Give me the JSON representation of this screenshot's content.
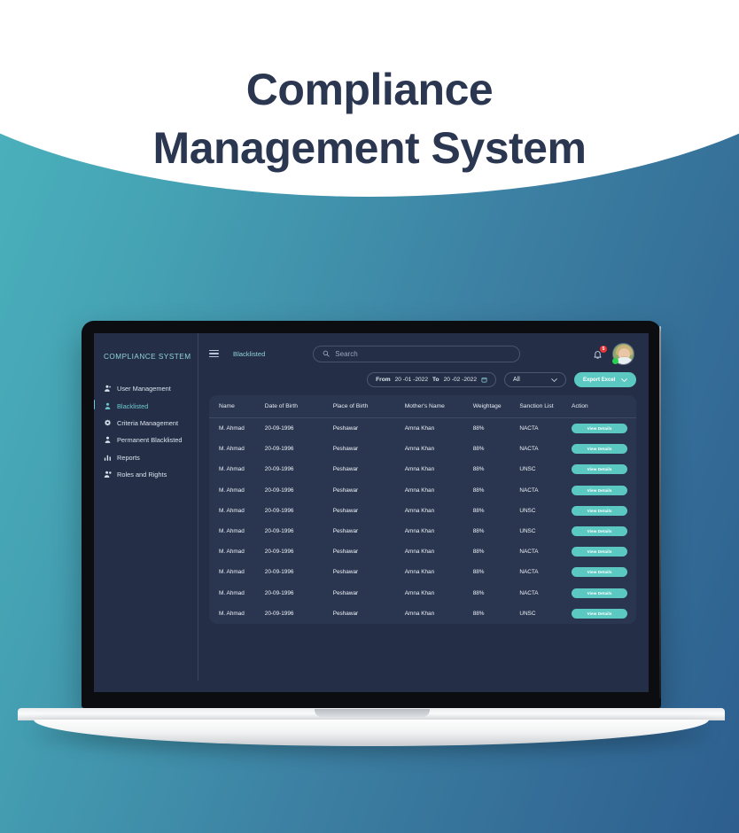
{
  "hero": {
    "title_line1": "Compliance",
    "title_line2": "Management System",
    "title_color": "#2b3750"
  },
  "theme": {
    "background_left": "#4cb3bd",
    "background_right": "#2d5e8e",
    "app_background": "#242f47",
    "card_background": "#2a3650",
    "accent": "#5cc8c2",
    "active_nav": "#6fc9cf",
    "badge_red": "#e8363b",
    "online_green": "#2ad04f"
  },
  "sidebar": {
    "brand": "COMPLIANCE SYSTEM",
    "items": [
      {
        "label": "User Management",
        "icon": "users-icon",
        "active": false
      },
      {
        "label": "Blacklisted",
        "icon": "user-block-icon",
        "active": true
      },
      {
        "label": "Criteria Management",
        "icon": "gear-icon",
        "active": false
      },
      {
        "label": "Permanent Blacklisted",
        "icon": "user-icon",
        "active": false
      },
      {
        "label": "Reports",
        "icon": "bar-chart-icon",
        "active": false
      },
      {
        "label": "Roles and Rights",
        "icon": "user-settings-icon",
        "active": false
      }
    ]
  },
  "topbar": {
    "menu_icon": "hamburger-icon",
    "breadcrumb": "Blacklisted",
    "search": {
      "icon": "search-icon",
      "placeholder": "Search",
      "value": ""
    },
    "notifications": {
      "icon": "bell-icon",
      "count": "5"
    },
    "avatar": {
      "icon": "avatar",
      "status": "online"
    }
  },
  "filters": {
    "date_range": {
      "from_label": "From",
      "from_value": "20 -01 -2022",
      "to_label": "To",
      "to_value": "20 -02 -2022",
      "icon": "calendar-icon"
    },
    "category_select": {
      "value": "All",
      "icon": "chevron-down-icon"
    },
    "export_button": {
      "label": "Export Excel",
      "icon": "chevron-down-icon"
    }
  },
  "table": {
    "columns": [
      "Name",
      "Date of Birth",
      "Place of Birth",
      "Mother's Name",
      "Weightage",
      "Sanction List",
      "Action"
    ],
    "action_label": "View Details",
    "rows": [
      {
        "name": "M. Ahmad",
        "dob": "20-09-1996",
        "pob": "Peshawar",
        "mother": "Amna Khan",
        "weightage": "88%",
        "sanction": "NACTA"
      },
      {
        "name": "M. Ahmad",
        "dob": "20-09-1996",
        "pob": "Peshawar",
        "mother": "Amna Khan",
        "weightage": "88%",
        "sanction": "NACTA"
      },
      {
        "name": "M. Ahmad",
        "dob": "20-09-1996",
        "pob": "Peshawar",
        "mother": "Amna Khan",
        "weightage": "88%",
        "sanction": "UNSC"
      },
      {
        "name": "M. Ahmad",
        "dob": "20-09-1996",
        "pob": "Peshawar",
        "mother": "Amna Khan",
        "weightage": "88%",
        "sanction": "NACTA"
      },
      {
        "name": "M. Ahmad",
        "dob": "20-09-1996",
        "pob": "Peshawar",
        "mother": "Amna Khan",
        "weightage": "88%",
        "sanction": "UNSC"
      },
      {
        "name": "M. Ahmad",
        "dob": "20-09-1996",
        "pob": "Peshawar",
        "mother": "Amna Khan",
        "weightage": "88%",
        "sanction": "UNSC"
      },
      {
        "name": "M. Ahmad",
        "dob": "20-09-1996",
        "pob": "Peshawar",
        "mother": "Amna Khan",
        "weightage": "88%",
        "sanction": "NACTA"
      },
      {
        "name": "M. Ahmad",
        "dob": "20-09-1996",
        "pob": "Peshawar",
        "mother": "Amna Khan",
        "weightage": "88%",
        "sanction": "NACTA"
      },
      {
        "name": "M. Ahmad",
        "dob": "20-09-1996",
        "pob": "Peshawar",
        "mother": "Amna Khan",
        "weightage": "88%",
        "sanction": "NACTA"
      },
      {
        "name": "M. Ahmad",
        "dob": "20-09-1996",
        "pob": "Peshawar",
        "mother": "Amna Khan",
        "weightage": "88%",
        "sanction": "UNSC"
      }
    ]
  }
}
